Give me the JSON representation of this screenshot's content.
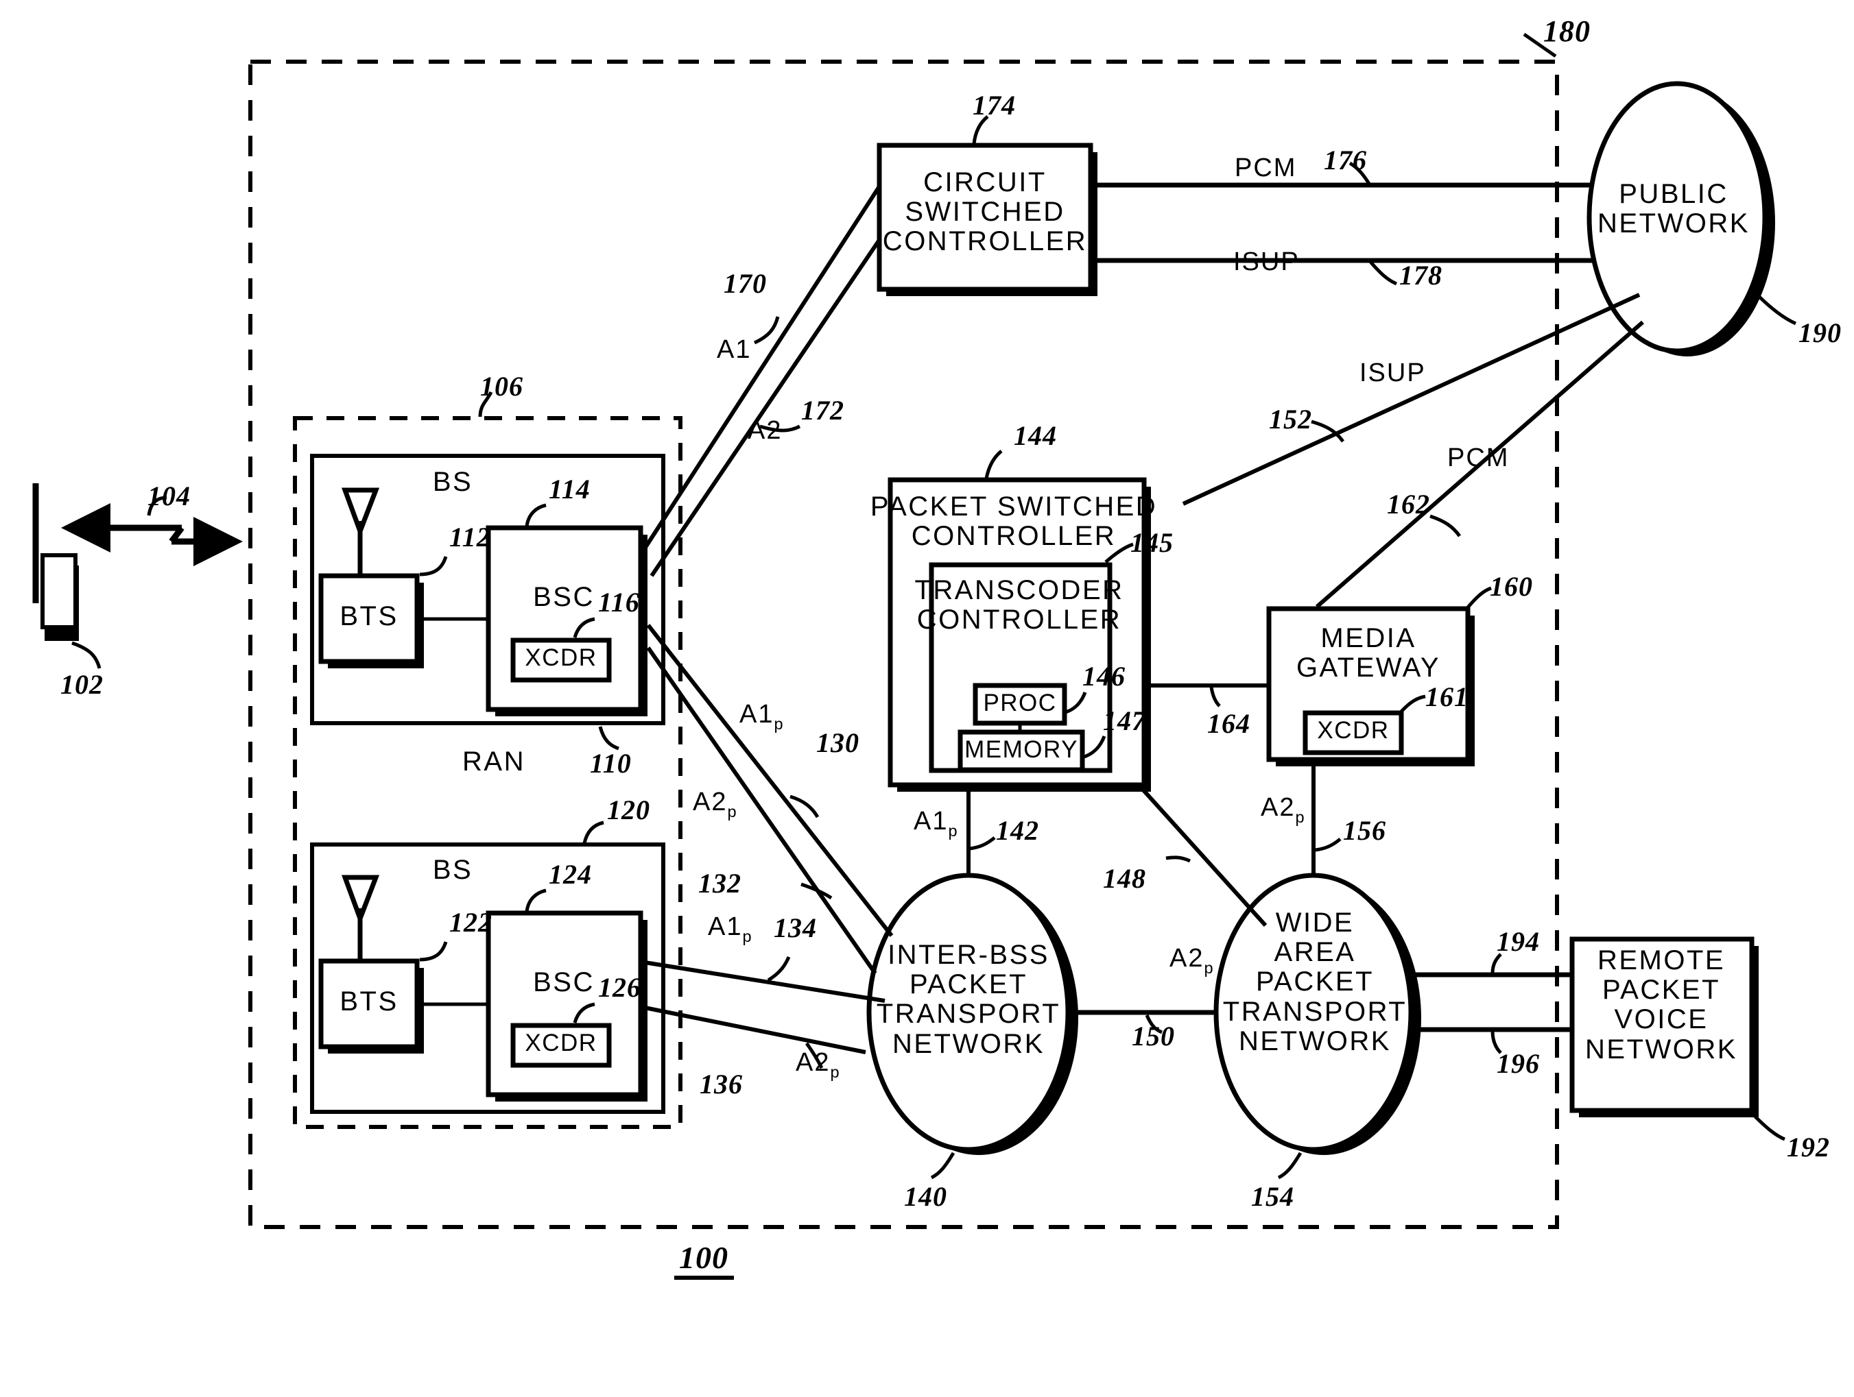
{
  "figure": {
    "figure_ref": "100",
    "outer_system_ref": "180"
  },
  "nodes": {
    "mobile": {
      "ref": "102",
      "link_ref": "104"
    },
    "ran": {
      "label": "RAN",
      "ref": "106"
    },
    "bs1": {
      "label": "BS",
      "ref": "110"
    },
    "bts1": {
      "label": "BTS",
      "ref": "112"
    },
    "bsc1": {
      "label": "BSC",
      "ref": "114"
    },
    "xcdr1": {
      "label": "XCDR",
      "ref": "116"
    },
    "bs2": {
      "label": "BS",
      "ref": "120"
    },
    "bts2": {
      "label": "BTS",
      "ref": "122"
    },
    "bsc2": {
      "label": "BSC",
      "ref": "124"
    },
    "xcdr2": {
      "label": "XCDR",
      "ref": "126"
    },
    "circuit_switched_controller": {
      "label": "CIRCUIT\nSWITCHED\nCONTROLLER",
      "ref": "174"
    },
    "packet_switched_controller": {
      "label": "PACKET SWITCHED\nCONTROLLER",
      "ref": "144"
    },
    "transcoder_controller": {
      "label": "TRANSCODER\nCONTROLLER",
      "ref": "145"
    },
    "proc": {
      "label": "PROC",
      "ref": "146"
    },
    "memory": {
      "label": "MEMORY",
      "ref": "147"
    },
    "media_gateway": {
      "label": "MEDIA\nGATEWAY",
      "ref": "160"
    },
    "xcdr_mg": {
      "label": "XCDR",
      "ref": "161"
    },
    "inter_bss_network": {
      "label": "INTER-BSS\nPACKET\nTRANSPORT\nNETWORK",
      "ref": "140"
    },
    "wide_area_network": {
      "label": "WIDE\nAREA\nPACKET\nTRANSPORT\nNETWORK",
      "ref": "154"
    },
    "public_network": {
      "label": "PUBLIC\nNETWORK",
      "ref": "190"
    },
    "remote_packet_voice_network": {
      "label": "REMOTE\nPACKET\nVOICE\nNETWORK",
      "ref": "192"
    }
  },
  "links": [
    {
      "name": "bsc1-to-csc-a1",
      "protocol": "A1",
      "ref": "170"
    },
    {
      "name": "bsc1-to-csc-a2",
      "protocol": "A2",
      "ref": "172"
    },
    {
      "name": "csc-to-public-pcm",
      "protocol": "PCM",
      "ref": "176"
    },
    {
      "name": "csc-to-public-isup",
      "protocol": "ISUP",
      "ref": "178"
    },
    {
      "name": "bsc1-to-interbss-a1p",
      "protocol": "A1",
      "protocol_sub": "p",
      "ref": "130"
    },
    {
      "name": "bsc1-to-interbss-a2p",
      "protocol": "A2",
      "protocol_sub": "p",
      "ref": "132"
    },
    {
      "name": "bsc2-to-interbss-a1p",
      "protocol": "A1",
      "protocol_sub": "p",
      "ref": "134"
    },
    {
      "name": "bsc2-to-interbss-a2p",
      "protocol": "A2",
      "protocol_sub": "p",
      "ref": "136"
    },
    {
      "name": "psc-to-interbss-a1p",
      "protocol": "A1",
      "protocol_sub": "p",
      "ref": "142"
    },
    {
      "name": "psc-to-wide-area",
      "protocol": "",
      "ref": "148"
    },
    {
      "name": "interbss-to-wide-area-a2p",
      "protocol": "A2",
      "protocol_sub": "p",
      "ref": "150"
    },
    {
      "name": "psc-to-public-isup",
      "protocol": "ISUP",
      "ref": "152"
    },
    {
      "name": "mg-to-wide-area-a2p",
      "protocol": "A2",
      "protocol_sub": "p",
      "ref": "156"
    },
    {
      "name": "mg-to-public-pcm",
      "protocol": "PCM",
      "ref": "162"
    },
    {
      "name": "psc-to-mg",
      "protocol": "",
      "ref": "164"
    },
    {
      "name": "wide-area-to-remote-1",
      "protocol": "",
      "ref": "194"
    },
    {
      "name": "wide-area-to-remote-2",
      "protocol": "",
      "ref": "196"
    }
  ]
}
